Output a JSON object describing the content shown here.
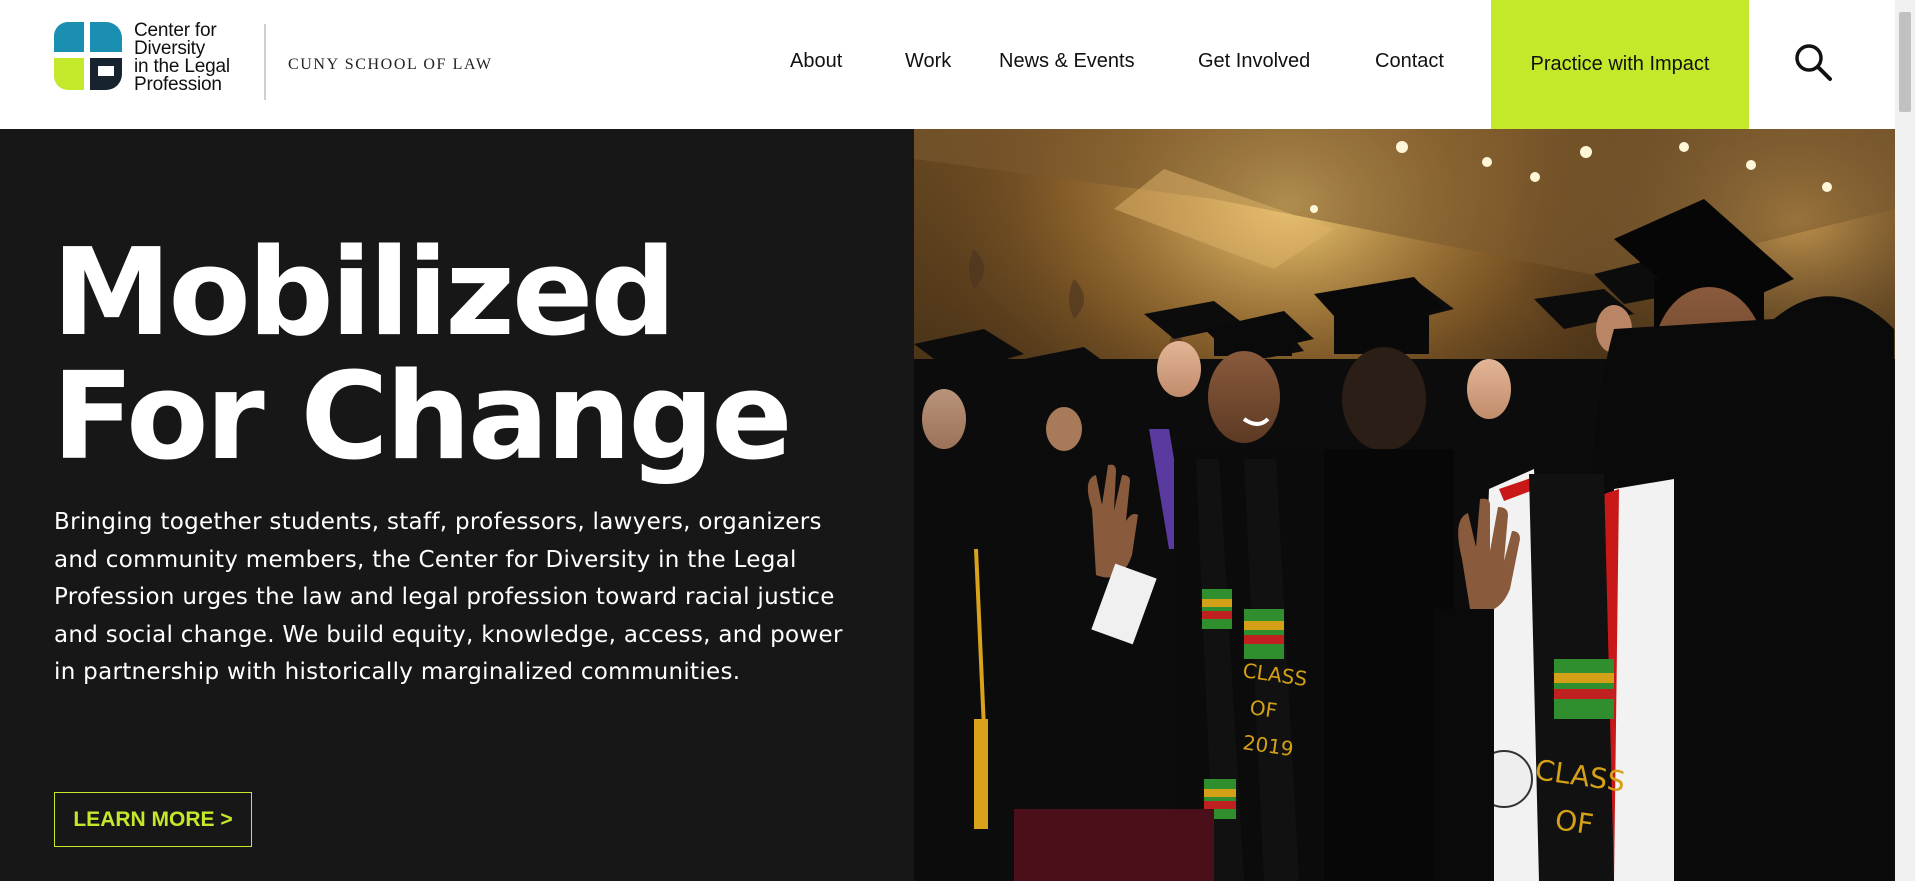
{
  "brand": {
    "logo_lines": [
      "Center for",
      "Diversity",
      "in the Legal",
      "Profession"
    ],
    "partner": "CUNY SCHOOL OF LAW",
    "colors": {
      "teal": "#1b8fb1",
      "lime": "#c4e82a",
      "dark": "#17242f"
    }
  },
  "nav": {
    "items": [
      "About",
      "Work",
      "News & Events",
      "Get Involved",
      "Contact"
    ],
    "cta": "Practice with Impact",
    "search_icon": "search-icon"
  },
  "hero": {
    "title_line1": "Mobilized",
    "title_line2": "For Change",
    "body": "Bringing together students, staff, professors, lawyers, organizers and community members, the Center for Diversity in the Legal Profession urges the law and legal profession toward racial justice and social change. We build equity, knowledge, access, and power in partnership with historically marginalized communities.",
    "cta": "LEARN MORE >",
    "photo": {
      "stole_text_1": [
        "CLASS",
        "OF",
        "2019"
      ],
      "stole_text_2": [
        "CLASS",
        "OF"
      ]
    }
  },
  "colors": {
    "accent": "#c4e82a",
    "hero_bg": "#171717"
  }
}
